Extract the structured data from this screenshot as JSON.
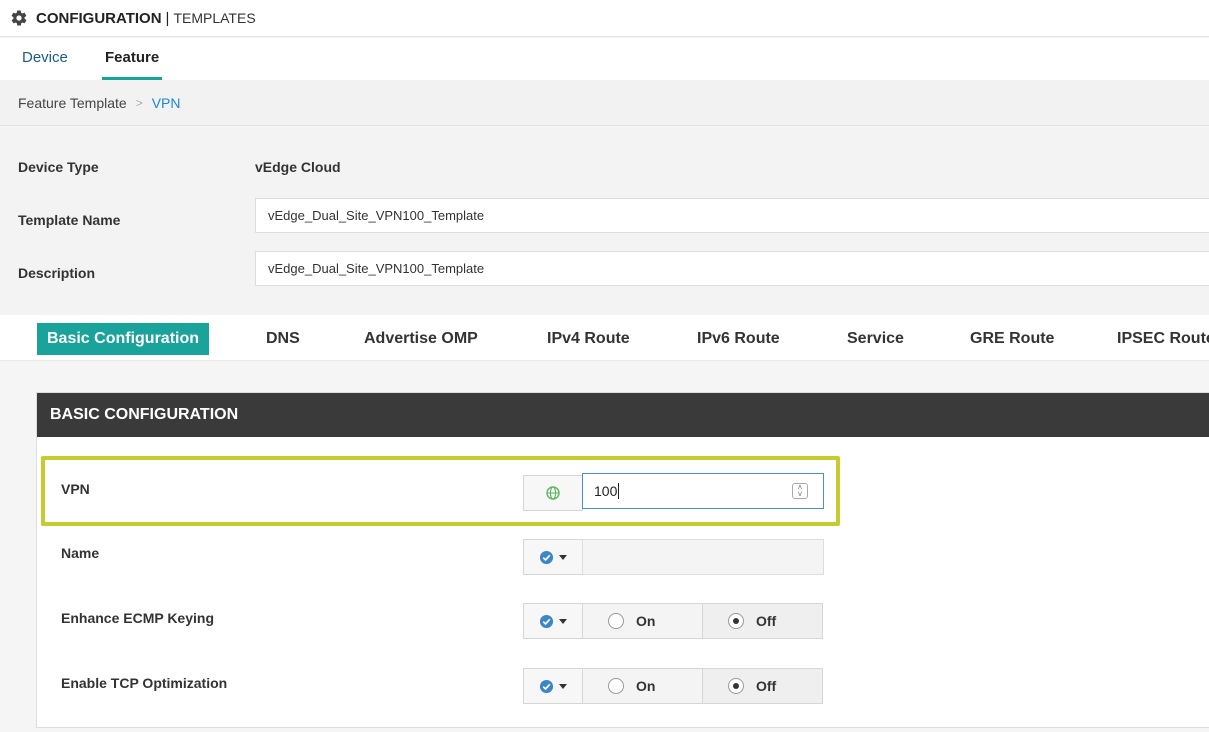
{
  "header": {
    "title": "CONFIGURATION",
    "separator": "|",
    "subtitle": "TEMPLATES"
  },
  "subtabs": [
    {
      "label": "Device"
    },
    {
      "label": "Feature"
    }
  ],
  "breadcrumb": {
    "parent": "Feature Template",
    "separator": ">",
    "current": "VPN"
  },
  "form": {
    "device_type_label": "Device Type",
    "device_type_value": "vEdge Cloud",
    "template_name_label": "Template Name",
    "template_name_value": "vEdge_Dual_Site_VPN100_Template",
    "description_label": "Description",
    "description_value": "vEdge_Dual_Site_VPN100_Template"
  },
  "section_tabs": [
    {
      "label": "Basic Configuration"
    },
    {
      "label": "DNS"
    },
    {
      "label": "Advertise OMP"
    },
    {
      "label": "IPv4 Route"
    },
    {
      "label": "IPv6 Route"
    },
    {
      "label": "Service"
    },
    {
      "label": "GRE Route"
    },
    {
      "label": "IPSEC Route"
    }
  ],
  "basic": {
    "heading": "BASIC CONFIGURATION",
    "vpn_label": "VPN",
    "vpn_value": "100",
    "name_label": "Name",
    "ecmp_label": "Enhance ECMP Keying",
    "tcp_label": "Enable TCP Optimization",
    "on_label": "On",
    "off_label": "Off"
  },
  "colors": {
    "accent": "#1aa39b",
    "link": "#1b87d6",
    "highlight": "#c4cc2e",
    "header_dark": "#3a3a3a",
    "check_blue": "#3b86c6",
    "globe_green": "#5cb85c"
  },
  "icons": {
    "header": "gear-icon",
    "global_scope": "globe-icon",
    "default_scope": "check-circle-icon"
  }
}
